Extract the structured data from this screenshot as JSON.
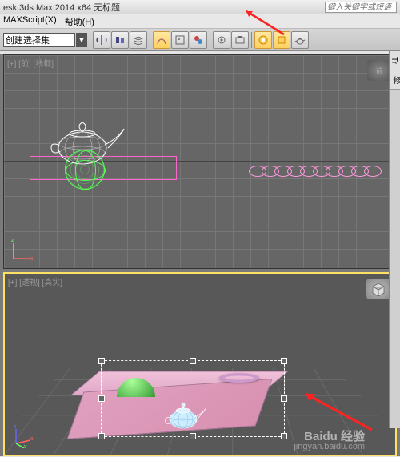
{
  "title": "esk 3ds Max  2014 x64   无标题",
  "menu": {
    "maxscript": "MAXScript(X)",
    "help": "帮助(H)"
  },
  "search": {
    "placeholder": "键入关键字或短语"
  },
  "toolbar": {
    "dropdown": "创建选择集"
  },
  "viewport_top": {
    "label": "[+] [前] [线框]",
    "cube": "前"
  },
  "viewport_bottom": {
    "label": "[+] [透视] [真实]"
  },
  "side": {
    "tab1": "Tr",
    "tab2": "修"
  },
  "watermark": {
    "logo": "Baidu 经验",
    "url": "jingyan.baidu.com"
  }
}
